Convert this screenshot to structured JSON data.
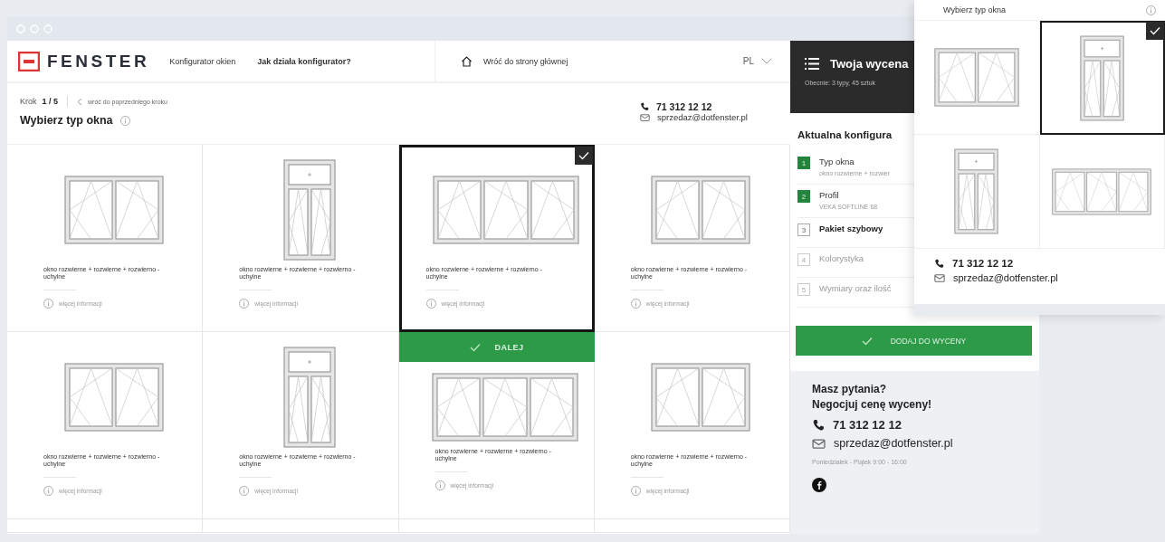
{
  "header": {
    "logo": "FENSTER",
    "configurator_link": "Konfigurator okien",
    "help_link": "Jak działa konfigurator?",
    "home_link": "Wróć do strony głównej",
    "language": "PL"
  },
  "quote": {
    "title": "Twoja wycena",
    "summary": "Obecnie: 3 typy, 45 sztuk"
  },
  "step": {
    "label": "Krok",
    "value": "1 / 5",
    "back_link": "wróć do poprzedniego kroku",
    "title": "Wybierz typ okna"
  },
  "contact": {
    "phone": "71 312 12 12",
    "email": "sprzedaz@dotfenster.pl"
  },
  "options": [
    {
      "kind": "double",
      "description": "okno rozwierne + rozwierne + rozwierno - uchylne",
      "more": "więcej informacji",
      "selected": false
    },
    {
      "kind": "transom",
      "description": "okno rozwierne + rozwierne + rozwierno - uchylne",
      "more": "więcej informacji",
      "selected": false
    },
    {
      "kind": "triple",
      "description": "okno rozwierne + rozwierne + rozwierno - uchylne",
      "more": "więcej informacji",
      "selected": true
    },
    {
      "kind": "double",
      "description": "okno rozwierne + rozwierne + rozwierno - uchylne",
      "more": "więcej informacji",
      "selected": false
    },
    {
      "kind": "double",
      "description": "okno rozwierne + rozwierne + rozwierno - uchylne",
      "more": "więcej informacji",
      "selected": false
    },
    {
      "kind": "transom",
      "description": "okno rozwierne + rozwierne + rozwierno - uchylne",
      "more": "więcej informacji",
      "selected": false
    },
    {
      "kind": "triple",
      "description": "okno rozwierne + rozwierne + rozwierno - uchylne",
      "more": "więcej informacji",
      "selected": false
    },
    {
      "kind": "double",
      "description": "okno rozwierne + rozwierne + rozwierno - uchylne",
      "more": "więcej informacji",
      "selected": false
    }
  ],
  "next_button": "DALEJ",
  "config": {
    "title": "Aktualna konfigura",
    "steps": [
      {
        "number": "1",
        "label": "Typ okna",
        "detail": "okno rozwierne + rozwier",
        "completed": true,
        "active": false
      },
      {
        "number": "2",
        "label": "Profil",
        "detail": "VEKA SOFTLINE 68",
        "completed": true,
        "active": false
      },
      {
        "number": "3",
        "label": "Pakiet szybowy",
        "completed": false,
        "active": true
      },
      {
        "number": "4",
        "label": "Kolorystyka",
        "completed": false,
        "active": false
      },
      {
        "number": "5",
        "label": "Wymiary oraz ilość",
        "completed": false,
        "active": false
      }
    ]
  },
  "add_button": "DODAJ DO WYCENY",
  "help": {
    "question": "Masz pytania?",
    "prompt": "Negocjuj cenę wyceny!",
    "phone": "71 312 12 12",
    "email": "sprzedaz@dotfenster.pl",
    "hours": "Poniedziałek - Piątek 9:00 - 16:00"
  },
  "mobile_preview": {
    "title": "Wybierz typ okna",
    "options": [
      {
        "kind": "double",
        "selected": false
      },
      {
        "kind": "transom",
        "selected": true
      },
      {
        "kind": "transom",
        "selected": false
      },
      {
        "kind": "triple",
        "selected": false
      }
    ],
    "phone": "71 312 12 12",
    "email": "sprzedaz@dotfenster.pl"
  }
}
